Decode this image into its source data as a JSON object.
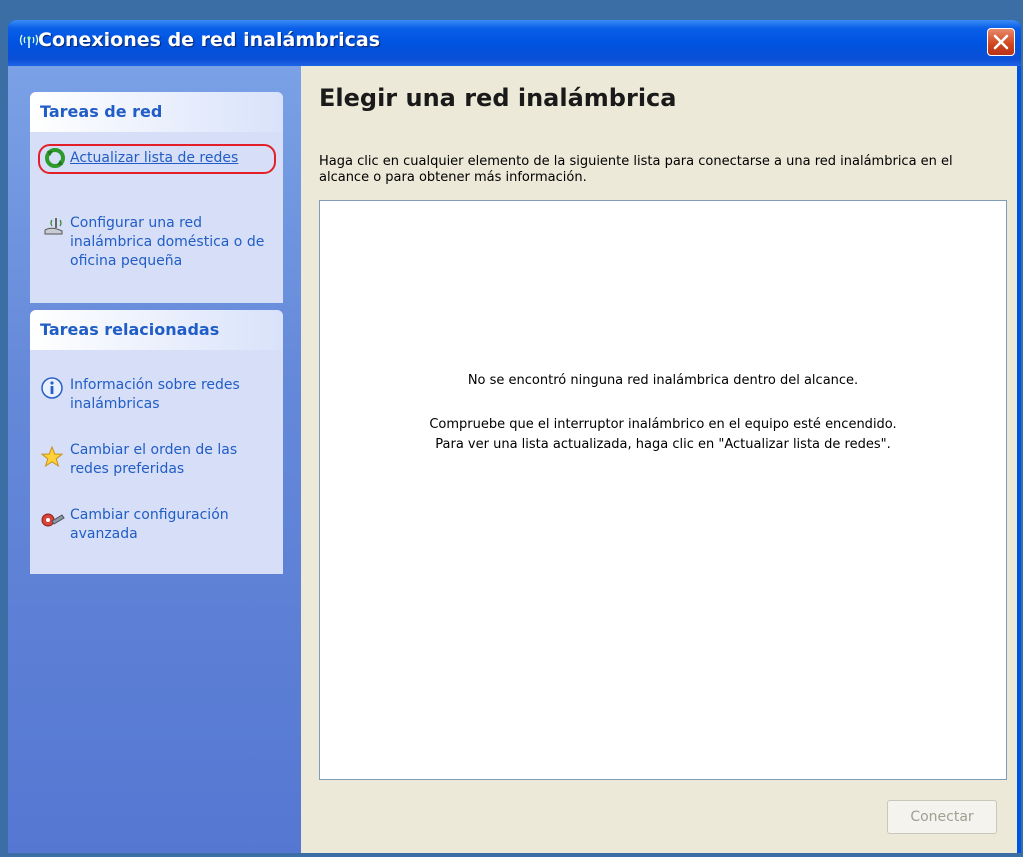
{
  "window": {
    "title": "Conexiones de red inalámbricas",
    "title_icon": "wireless-antenna-icon",
    "close_icon": "close-icon"
  },
  "left_panel": {
    "network_tasks": {
      "header": "Tareas de red",
      "items": [
        {
          "label": "Actualizar lista de redes",
          "icon": "refresh-icon",
          "highlighted": true
        },
        {
          "label": "Configurar una red inalámbrica doméstica o de oficina pequeña",
          "icon": "wireless-setup-icon"
        }
      ]
    },
    "related_tasks": {
      "header": "Tareas relacionadas",
      "items": [
        {
          "label": "Información sobre redes inalámbricas",
          "icon": "info-icon"
        },
        {
          "label": "Cambiar el orden de las redes preferidas",
          "icon": "star-icon"
        },
        {
          "label": "Cambiar configuración avanzada",
          "icon": "settings-icon"
        }
      ]
    }
  },
  "main": {
    "title": "Elegir una red inalámbrica",
    "description": "Haga clic en cualquier elemento de la siguiente lista para conectarse a una red inalámbrica en el alcance o para obtener más información.",
    "list": {
      "message1": "No se encontró ninguna red inalámbrica dentro del alcance.",
      "message2": "Compruebe que el interruptor inalámbrico en el equipo esté encendido.",
      "message3": "Para ver una lista actualizada, haga clic en \"Actualizar lista de redes\"."
    },
    "connect_button": "Conectar"
  },
  "colors": {
    "titlebar": "#0053e1",
    "task_link": "#215dc6",
    "highlight_border": "#e3202a"
  }
}
